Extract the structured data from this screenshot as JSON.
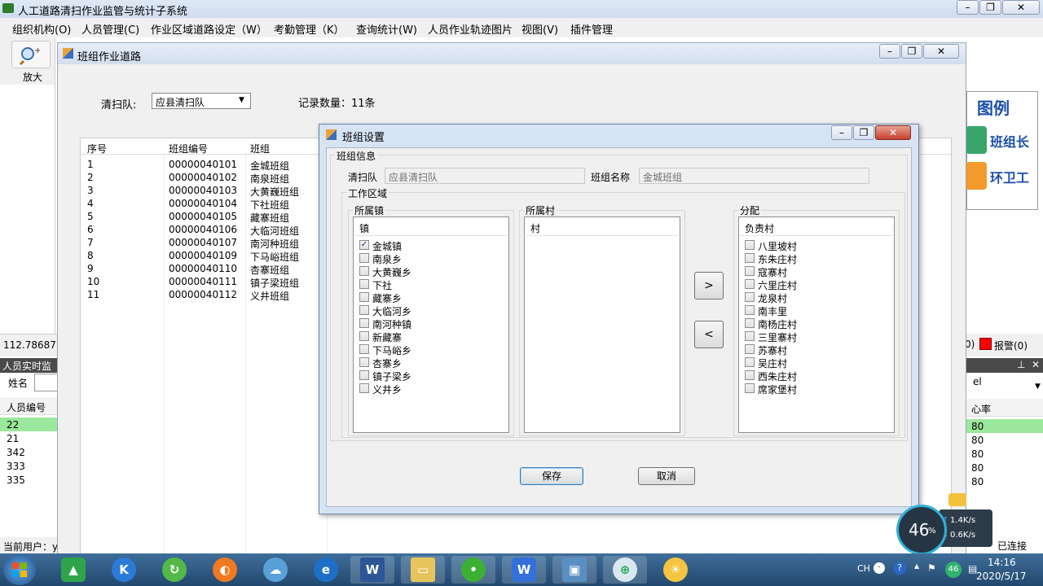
{
  "main": {
    "title": "人工道路清扫作业监管与统计子系统",
    "menu": [
      "组织机构(O)",
      "人员管理(C)",
      "作业区域道路设定（W）",
      "考勤管理（K）",
      "查询统计(W)",
      "人员作业轨迹图片",
      "视图(V)",
      "插件管理"
    ],
    "toolbar_zoom": "放大",
    "coord": "112.78687",
    "realtime_header": "人员实时监",
    "name_label": "姓名",
    "realtime_columns": [
      "人员编号"
    ],
    "realtime_rows": [
      "22",
      "21",
      "342",
      "333",
      "335"
    ],
    "current_user": "当前用户：y"
  },
  "legend": {
    "title": "图例",
    "items": [
      "班组长",
      "环卫工"
    ]
  },
  "right_panel": {
    "alarm": "报警(0)",
    "prefix": "0)",
    "el_text": "el",
    "hr_header": "心率",
    "hr_values": [
      "80",
      "80",
      "80",
      "80",
      "80"
    ],
    "connected": "已连接"
  },
  "child_window": {
    "title": "班组作业道路",
    "team_label": "清扫队:",
    "team_value": "应县清扫队",
    "record_count": "记录数量：11条",
    "columns": [
      "序号",
      "班组编号",
      "班组"
    ],
    "rows": [
      [
        "1",
        "00000040101",
        "金城班组"
      ],
      [
        "2",
        "00000040102",
        "南泉班组"
      ],
      [
        "3",
        "00000040103",
        "大黄巍班组"
      ],
      [
        "4",
        "00000040104",
        "下社班组"
      ],
      [
        "5",
        "00000040105",
        "藏寨班组"
      ],
      [
        "6",
        "00000040106",
        "大临河班组"
      ],
      [
        "7",
        "00000040107",
        "南河种班组"
      ],
      [
        "8",
        "00000040109",
        "下马峪班组"
      ],
      [
        "9",
        "00000040110",
        "杏寨班组"
      ],
      [
        "10",
        "00000040111",
        "镇子梁班组"
      ],
      [
        "11",
        "00000040112",
        "义井班组"
      ]
    ]
  },
  "dialog": {
    "title": "班组设置",
    "group_info": "班组信息",
    "team_label": "清扫队",
    "team_value": "应县清扫队",
    "group_name_label": "班组名称",
    "group_name_value": "金城班组",
    "work_area": "工作区域",
    "town_group": "所属镇",
    "town_column": "镇",
    "towns": [
      {
        "name": "金城镇",
        "checked": true
      },
      {
        "name": "南泉乡",
        "checked": false
      },
      {
        "name": "大黄巍乡",
        "checked": false
      },
      {
        "name": "下社",
        "checked": false
      },
      {
        "name": "藏寨乡",
        "checked": false
      },
      {
        "name": "大临河乡",
        "checked": false
      },
      {
        "name": "南河种镇",
        "checked": false
      },
      {
        "name": "新藏寨",
        "checked": false
      },
      {
        "name": "下马峪乡",
        "checked": false
      },
      {
        "name": "杏寨乡",
        "checked": false
      },
      {
        "name": "镇子梁乡",
        "checked": false
      },
      {
        "name": "义井乡",
        "checked": false
      }
    ],
    "village_group": "所属村",
    "village_column": "村",
    "assign_group": "分配",
    "assign_column": "负责村",
    "assigned": [
      {
        "name": "八里坡村",
        "checked": false
      },
      {
        "name": "东朱庄村",
        "checked": false
      },
      {
        "name": "寇寨村",
        "checked": false
      },
      {
        "name": "六里庄村",
        "checked": false
      },
      {
        "name": "龙泉村",
        "checked": false
      },
      {
        "name": "南丰里",
        "checked": false
      },
      {
        "name": "南杨庄村",
        "checked": false
      },
      {
        "name": "三里寨村",
        "checked": false
      },
      {
        "name": "苏寨村",
        "checked": false
      },
      {
        "name": "吴庄村",
        "checked": false
      },
      {
        "name": "西朱庄村",
        "checked": false
      },
      {
        "name": "席家堡村",
        "checked": false
      }
    ],
    "add_arrow": ">",
    "remove_arrow": "<",
    "save": "保存",
    "cancel": "取消"
  },
  "net_widget": {
    "percent": "46",
    "percent_sign": "%",
    "up": "1.4K/s",
    "down": "0.6K/s"
  },
  "taskbar": {
    "time": "14:16",
    "date": "2020/5/17",
    "lang": "CH",
    "badge": "46"
  }
}
